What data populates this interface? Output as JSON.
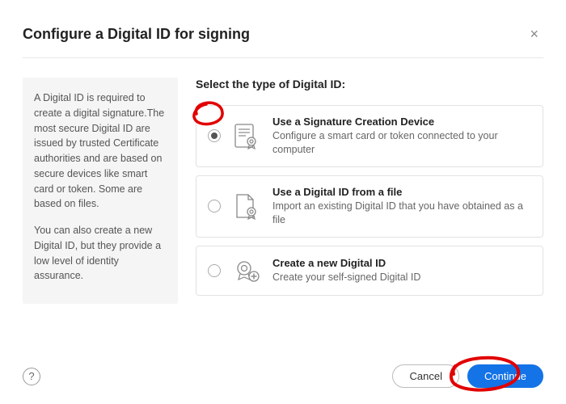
{
  "header": {
    "title": "Configure a Digital ID for signing",
    "close_label": "×"
  },
  "sidebar": {
    "para1": "A Digital ID is required to create a digital signature.The most secure Digital ID are issued by trusted Certificate authorities and are based on secure devices like smart card or token. Some are based on files.",
    "para2": "You can also create a new Digital ID, but they provide a low level of identity assurance."
  },
  "main": {
    "prompt": "Select the type of Digital ID:",
    "options": [
      {
        "title": "Use a Signature Creation Device",
        "desc": "Configure a smart card or token connected to your computer",
        "selected": true,
        "icon": "certificate-device-icon"
      },
      {
        "title": "Use a Digital ID from a file",
        "desc": "Import an existing Digital ID that you have obtained as a file",
        "selected": false,
        "icon": "file-id-icon"
      },
      {
        "title": "Create a new Digital ID",
        "desc": "Create your self-signed Digital ID",
        "selected": false,
        "icon": "new-id-icon"
      }
    ]
  },
  "footer": {
    "help_label": "?",
    "cancel_label": "Cancel",
    "continue_label": "Continue"
  },
  "colors": {
    "primary": "#1473e6",
    "annotation": "#e20000"
  }
}
